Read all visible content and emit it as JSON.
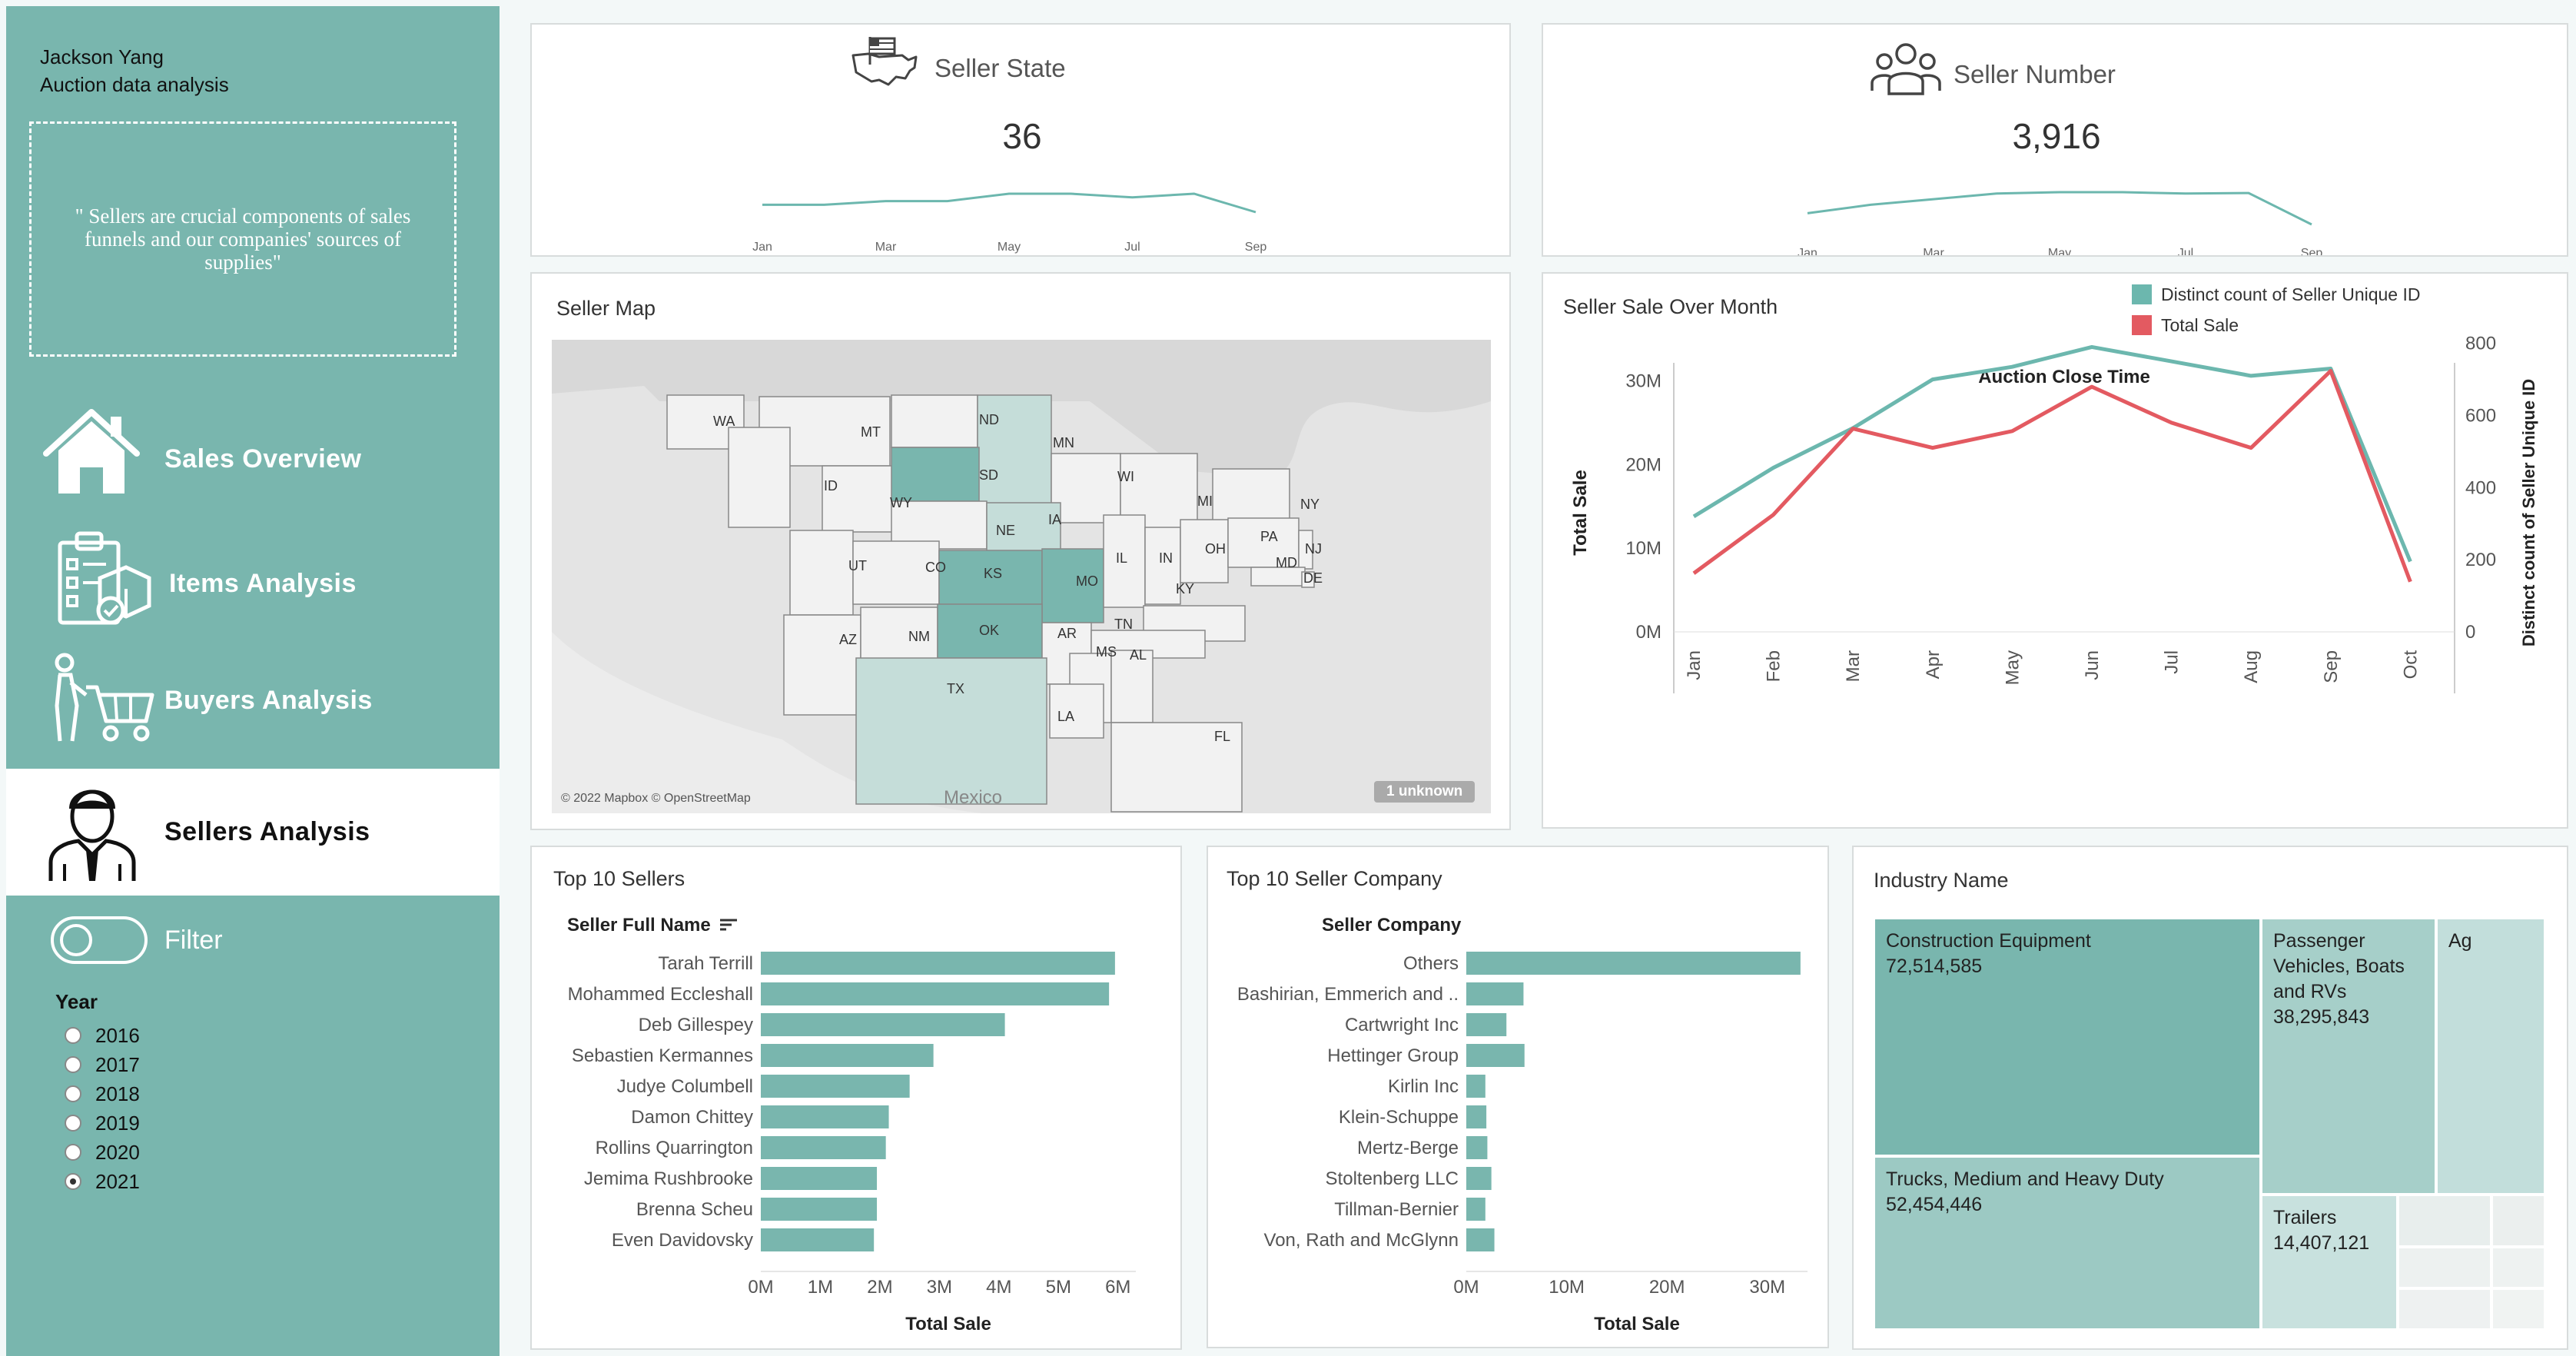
{
  "sidebar": {
    "author_name": "Jackson Yang",
    "subtitle": "Auction data analysis",
    "quote": "\" Sellers are crucial components of sales funnels and our companies' sources of supplies\"",
    "nav": [
      {
        "label": "Sales Overview",
        "icon": "house-icon"
      },
      {
        "label": "Items Analysis",
        "icon": "clipboard-box-icon"
      },
      {
        "label": "Buyers Analysis",
        "icon": "shopping-cart-person-icon"
      },
      {
        "label": "Sellers Analysis",
        "icon": "person-tie-icon",
        "active": true
      }
    ],
    "filter_label": "Filter",
    "year_title": "Year",
    "years": [
      "2016",
      "2017",
      "2018",
      "2019",
      "2020",
      "2021"
    ],
    "selected_year": "2021"
  },
  "kpi_state": {
    "title": "Seller State",
    "value": "36",
    "icon": "usa-flag-icon",
    "months": [
      "Jan",
      "Mar",
      "May",
      "Jul",
      "Sep"
    ],
    "spark": [
      30,
      30,
      31,
      31,
      33,
      33,
      32,
      33,
      28
    ]
  },
  "kpi_number": {
    "title": "Seller Number",
    "value": "3,916",
    "icon": "people-group-icon",
    "months": [
      "Jan",
      "Mar",
      "May",
      "Jul",
      "Sep"
    ],
    "spark": [
      300,
      330,
      350,
      370,
      375,
      375,
      370,
      372,
      260
    ]
  },
  "map": {
    "title": "Seller Map",
    "states": [
      "WA",
      "MT",
      "ND",
      "MN",
      "ID",
      "WY",
      "SD",
      "WI",
      "MI",
      "NY",
      "NE",
      "IA",
      "UT",
      "CO",
      "KS",
      "MO",
      "IL",
      "IN",
      "OH",
      "PA",
      "NJ",
      "MD",
      "DE",
      "KY",
      "AZ",
      "NM",
      "OK",
      "AR",
      "TN",
      "MS",
      "AL",
      "TX",
      "LA",
      "FL"
    ],
    "country_label": "Mexico",
    "attribution": "© 2022 Mapbox © OpenStreetMap",
    "unknown_badge": "1 unknown",
    "accent": "#79b6ae",
    "light": "#c5ddd9"
  },
  "line_chart": {
    "title": "Seller Sale Over Month",
    "legend": [
      {
        "label": "Distinct count of Seller Unique ID",
        "color": "#6cb7ae"
      },
      {
        "label": "Total Sale",
        "color": "#e35a61"
      }
    ],
    "top_title": "Auction Close Time"
  },
  "top_sellers": {
    "title": "Top 10 Sellers",
    "dim_header": "Seller Full Name",
    "axis_title": "Total Sale",
    "ticks": [
      "0M",
      "1M",
      "2M",
      "3M",
      "4M",
      "5M",
      "6M"
    ]
  },
  "top_companies": {
    "title": "Top 10 Seller Company",
    "dim_header": "Seller Company",
    "axis_title": "Total Sale",
    "ticks": [
      "0M",
      "10M",
      "20M",
      "30M"
    ]
  },
  "industry": {
    "title": "Industry Name",
    "cells": [
      {
        "name": "Construction Equipment",
        "value": "72,514,585"
      },
      {
        "name": "Trucks, Medium and Heavy Duty",
        "value": "52,454,446"
      },
      {
        "name": "Passenger Vehicles, Boats and RVs",
        "value": "38,295,843"
      },
      {
        "name": "Ag",
        "value": ""
      },
      {
        "name": "Trailers",
        "value": "14,407,121"
      }
    ]
  },
  "chart_data": [
    {
      "type": "line",
      "title": "Seller Sale Over Month",
      "x_title": "Auction Close Time",
      "x": [
        "Jan",
        "Feb",
        "Mar",
        "Apr",
        "May",
        "Jun",
        "Jul",
        "Aug",
        "Sep",
        "Oct"
      ],
      "ylabel": "Total Sale",
      "ylim": [
        0,
        34000000
      ],
      "yticks": [
        "0M",
        "10M",
        "20M",
        "30M"
      ],
      "y2label": "Distinct count of Seller Unique ID",
      "y2lim": [
        0,
        810
      ],
      "y2ticks": [
        "0",
        "200",
        "400",
        "600",
        "800"
      ],
      "series": [
        {
          "name": "Distinct count of Seller Unique ID",
          "axis": "right",
          "color": "#6cb7ae",
          "values": [
            320,
            455,
            565,
            700,
            735,
            790,
            750,
            710,
            730,
            195
          ]
        },
        {
          "name": "Total Sale",
          "axis": "left",
          "color": "#e35a61",
          "values": [
            7000000,
            14000000,
            24300000,
            22000000,
            24000000,
            29300000,
            25000000,
            22000000,
            31200000,
            6000000
          ]
        }
      ]
    },
    {
      "type": "bar",
      "title": "Top 10 Sellers",
      "orientation": "horizontal",
      "categories": [
        "Tarah Terrill",
        "Mohammed Eccleshall",
        "Deb Gillespey",
        "Sebastien Kermannes",
        "Judye Columbell",
        "Damon Chittey",
        "Rollins Quarrington",
        "Jemima Rushbrooke",
        "Brenna Scheu",
        "Even Davidovsky"
      ],
      "values": [
        5.95,
        5.85,
        4.1,
        2.9,
        2.5,
        2.15,
        2.1,
        1.95,
        1.95,
        1.9
      ],
      "xlabel": "Total Sale",
      "xlim": [
        0,
        6.3
      ],
      "unit": "M"
    },
    {
      "type": "bar",
      "title": "Top 10 Seller Company",
      "orientation": "horizontal",
      "categories": [
        "Others",
        "Bashirian, Emmerich and ..",
        "Cartwright Inc",
        "Hettinger Group",
        "Kirlin Inc",
        "Klein-Schuppe",
        "Mertz-Berge",
        "Stoltenberg LLC",
        "Tillman-Bernier",
        "Von, Rath and McGlynn"
      ],
      "values": [
        33.3,
        5.7,
        4.0,
        5.8,
        1.9,
        2.0,
        2.1,
        2.5,
        1.9,
        2.8
      ],
      "xlabel": "Total Sale",
      "xlim": [
        0,
        34
      ],
      "unit": "M"
    },
    {
      "type": "treemap",
      "title": "Industry Name",
      "categories": [
        "Construction Equipment",
        "Trucks, Medium and Heavy Duty",
        "Passenger Vehicles, Boats and RVs",
        "Trailers",
        "Ag"
      ],
      "values": [
        72514585,
        52454446,
        38295843,
        14407121,
        null
      ]
    }
  ]
}
